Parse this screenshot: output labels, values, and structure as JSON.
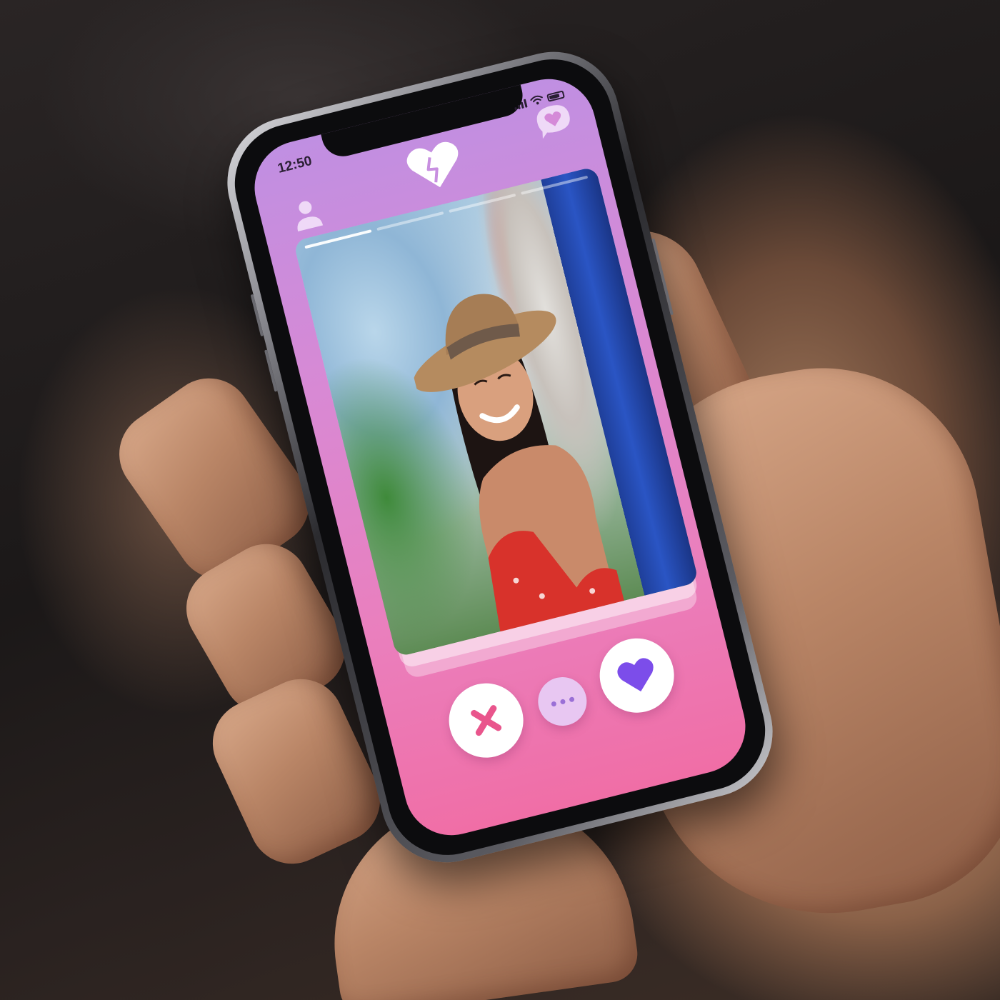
{
  "status_bar": {
    "time": "12:50"
  },
  "header": {
    "logo_icon": "broken-heart-logo-icon",
    "profile_icon": "user-profile-icon",
    "messages_icon": "heart-chat-bubble-icon"
  },
  "card": {
    "photo_count": 4,
    "active_photo_index": 0
  },
  "actions": {
    "dislike_icon": "close-x-icon",
    "more_icon": "more-dots-icon",
    "like_icon": "heart-icon"
  },
  "colors": {
    "gradient_top": "#c08fe2",
    "gradient_bottom": "#f06ea6",
    "dislike_accent": "#e9558c",
    "like_accent": "#7c4dea",
    "more_bg": "#e8c7f2"
  }
}
